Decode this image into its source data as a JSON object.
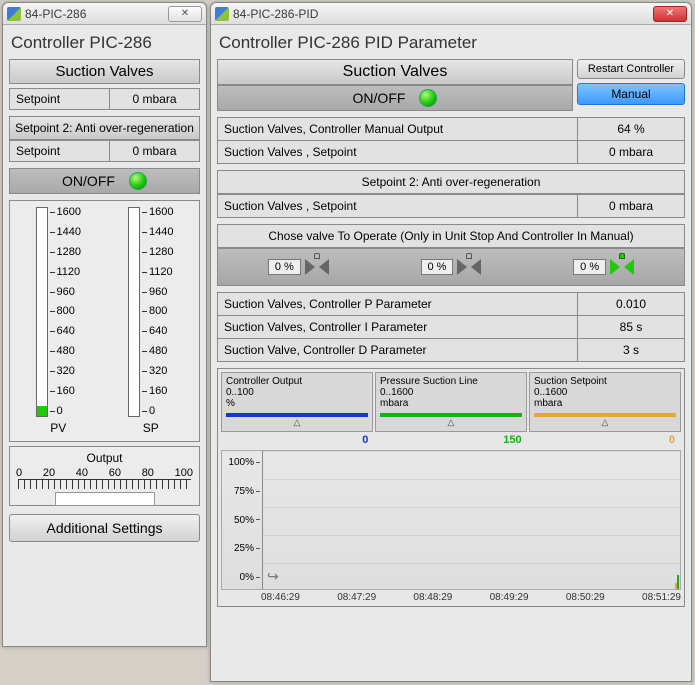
{
  "left": {
    "winTitle": "84-PIC-286",
    "heading": "Controller PIC-286",
    "group1Label": "Suction Valves",
    "setpointLabel": "Setpoint",
    "setpointValue": "0 mbara",
    "group2Label": "Setpoint 2: Anti over-regeneration",
    "setpoint2Label": "Setpoint",
    "setpoint2Value": "0 mbara",
    "onoffLabel": "ON/OFF",
    "scaleTicks": [
      "1600",
      "1440",
      "1280",
      "1120",
      "960",
      "800",
      "640",
      "480",
      "320",
      "160",
      "0"
    ],
    "pvLabel": "PV",
    "spLabel": "SP",
    "pvFillPct": 5,
    "spFillPct": 0,
    "outputLabel": "Output",
    "outputTicks": [
      "0",
      "20",
      "40",
      "60",
      "80",
      "100"
    ],
    "additional": "Additional Settings"
  },
  "right": {
    "winTitle": "84-PIC-286-PID",
    "heading": "Controller PIC-286 PID Parameter",
    "group1Label": "Suction Valves",
    "onoffLabel": "ON/OFF",
    "restart": "Restart Controller",
    "manual": "Manual",
    "rows1": [
      {
        "k": "Suction Valves, Controller Manual Output",
        "v": "64 %"
      },
      {
        "k": "Suction Valves , Setpoint",
        "v": "0 mbara"
      }
    ],
    "sp2Label": "Setpoint 2: Anti over-regeneration",
    "rows2": [
      {
        "k": "Suction Valves , Setpoint",
        "v": "0 mbara"
      }
    ],
    "choseLabel": "Chose valve To Operate (Only in Unit Stop And Controller In Manual)",
    "valvePct": [
      "0 %",
      "0 %",
      "0 %"
    ],
    "rows3": [
      {
        "k": "Suction Valves, Controller P Parameter",
        "v": "0.010"
      },
      {
        "k": "Suction Valves, Controller I Parameter",
        "v": "85 s"
      },
      {
        "k": "Suction Valve, Controller D Parameter",
        "v": "3 s"
      }
    ],
    "legend": [
      {
        "title": "Controller Output",
        "range": "0..100",
        "unit": "%",
        "color": "#1436d6",
        "val": "0"
      },
      {
        "title": "Pressure Suction Line",
        "range": "0..1600",
        "unit": "mbara",
        "color": "#17b01a",
        "val": "150"
      },
      {
        "title": "Suction Setpoint",
        "range": "0..1600",
        "unit": "mbara",
        "color": "#e7a63a",
        "val": "0"
      }
    ],
    "yTicks": [
      "100%",
      "75%",
      "50%",
      "25%",
      "0%"
    ],
    "xTicks": [
      "08:46:29",
      "08:47:29",
      "08:48:29",
      "08:49:29",
      "08:50:29",
      "08:51:29"
    ]
  },
  "chart_data": {
    "type": "line",
    "title": "",
    "series": [
      {
        "name": "Controller Output",
        "unit": "%",
        "range": [
          0,
          100
        ],
        "color": "#1436d6",
        "latest": 0
      },
      {
        "name": "Pressure Suction Line",
        "unit": "mbara",
        "range": [
          0,
          1600
        ],
        "color": "#17b01a",
        "latest": 150
      },
      {
        "name": "Suction Setpoint",
        "unit": "mbara",
        "range": [
          0,
          1600
        ],
        "color": "#e7a63a",
        "latest": 0
      }
    ],
    "x_ticks": [
      "08:46:29",
      "08:47:29",
      "08:48:29",
      "08:49:29",
      "08:50:29",
      "08:51:29"
    ],
    "y_ticks_pct": [
      0,
      25,
      50,
      75,
      100
    ],
    "note": "Plot body mostly empty; only brief spikes near rightmost time for green and orange series."
  }
}
